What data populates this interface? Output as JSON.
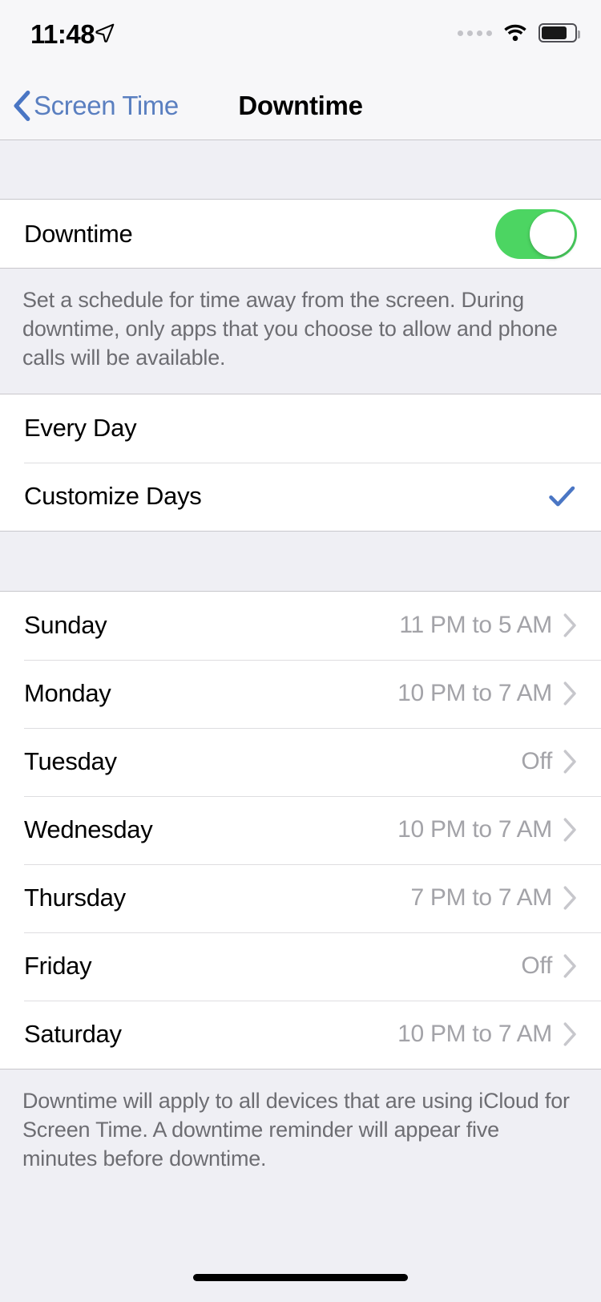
{
  "status_bar": {
    "time": "11:48",
    "location_icon": "location-arrow-icon",
    "signal_icon": "cellular-dots-icon",
    "signal_dots": 4,
    "wifi_icon": "wifi-icon",
    "battery_icon": "battery-icon",
    "battery_level_percent": 72
  },
  "nav": {
    "back_label": "Screen Time",
    "back_icon": "chevron-left-icon",
    "title": "Downtime"
  },
  "colors": {
    "accent_blue": "#5A7FC0",
    "toggle_green": "#4CD562",
    "checkmark_blue": "#4A76C4",
    "background": "#EFEFF4",
    "row_background": "#FFFFFF",
    "separator": "#C8C7CC",
    "secondary_text": "#A3A3A8",
    "note_text": "#6D6D72"
  },
  "downtime_section": {
    "toggle_row": {
      "label": "Downtime",
      "toggle_state": "on"
    },
    "note": "Set a schedule for time away from the screen. During downtime, only apps that you choose to allow and phone calls will be available."
  },
  "schedule_mode": {
    "options": [
      {
        "label": "Every Day",
        "selected": false
      },
      {
        "label": "Customize Days",
        "selected": true
      }
    ],
    "checkmark_icon": "checkmark-icon"
  },
  "days": {
    "chevron_icon": "chevron-right-icon",
    "rows": [
      {
        "day": "Sunday",
        "value": "11 PM to 5 AM"
      },
      {
        "day": "Monday",
        "value": "10 PM to 7 AM"
      },
      {
        "day": "Tuesday",
        "value": "Off"
      },
      {
        "day": "Wednesday",
        "value": "10 PM to 7 AM"
      },
      {
        "day": "Thursday",
        "value": "7 PM to 7 AM"
      },
      {
        "day": "Friday",
        "value": "Off"
      },
      {
        "day": "Saturday",
        "value": "10 PM to 7 AM"
      }
    ]
  },
  "footer": {
    "note": "Downtime will apply to all devices that are using iCloud for Screen Time. A downtime reminder will appear five minutes before downtime."
  },
  "home_indicator": "home-indicator"
}
